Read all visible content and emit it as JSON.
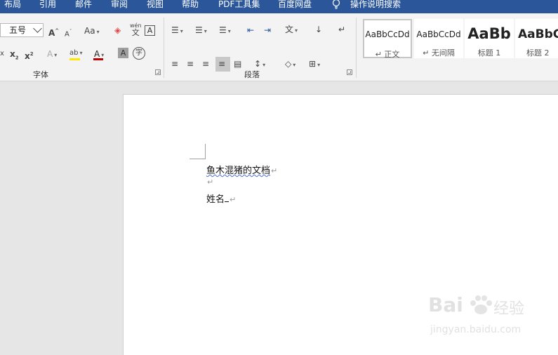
{
  "menu": {
    "tabs": [
      "布局",
      "引用",
      "邮件",
      "审阅",
      "视图",
      "帮助",
      "PDF工具集",
      "百度网盘"
    ],
    "tell_me": "操作说明搜索"
  },
  "ribbon": {
    "font_size": "五号",
    "groups": {
      "font": "字体",
      "paragraph": "段落"
    },
    "change_case": "Aa",
    "phonetic_top": "wén",
    "phonetic_bottom": "文",
    "char_border": "A",
    "enclose_char": "字",
    "char_shading": "A",
    "highlight_color": "#ffe600",
    "font_color": "#c00000",
    "styles": [
      {
        "sample": "AaBbCcDd",
        "name": "↵ 正文"
      },
      {
        "sample": "AaBbCcDd",
        "name": "↵ 无间隔"
      },
      {
        "sample": "AaBb",
        "name": "标题 1"
      },
      {
        "sample": "AaBbC",
        "name": "标题 2"
      }
    ]
  },
  "document": {
    "line1": "鱼木混猪的文档",
    "line3": "姓名",
    "pilcrow": "↵"
  },
  "watermark": {
    "brand": "Bai",
    "brand_suffix": "经验",
    "url": "jingyan.baidu.com"
  },
  "colors": {
    "title_bar": "#2b579a",
    "ribbon_bg": "#f3f3f3",
    "workspace_bg": "#e6e6e6"
  }
}
